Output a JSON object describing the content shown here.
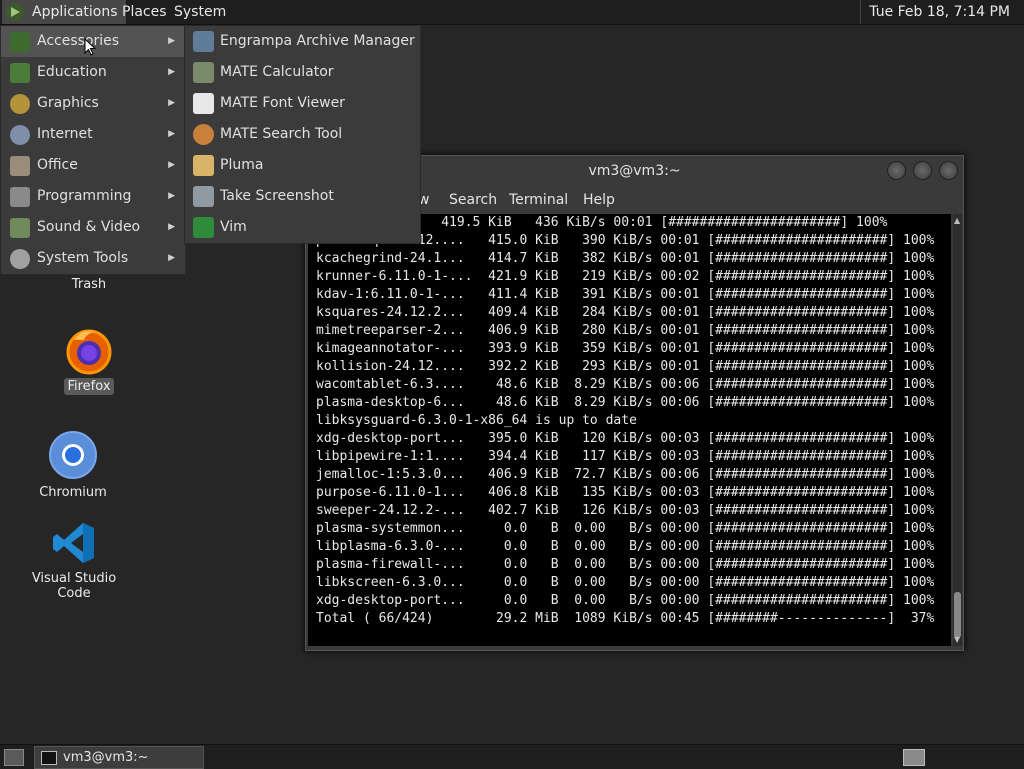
{
  "top_panel": {
    "applications": "Applications",
    "places": "Places",
    "system": "System",
    "clock": "Tue Feb 18,  7:14 PM"
  },
  "app_menu": {
    "items": [
      {
        "label": "Accessories",
        "icon": "accessories-icon"
      },
      {
        "label": "Education",
        "icon": "education-icon"
      },
      {
        "label": "Graphics",
        "icon": "graphics-icon"
      },
      {
        "label": "Internet",
        "icon": "internet-icon"
      },
      {
        "label": "Office",
        "icon": "office-icon"
      },
      {
        "label": "Programming",
        "icon": "programming-icon"
      },
      {
        "label": "Sound & Video",
        "icon": "sound-video-icon"
      },
      {
        "label": "System Tools",
        "icon": "system-tools-icon"
      }
    ]
  },
  "accessories_submenu": {
    "items": [
      {
        "label": "Engrampa Archive Manager",
        "icon": "archive-manager-icon"
      },
      {
        "label": "MATE Calculator",
        "icon": "calculator-icon"
      },
      {
        "label": "MATE Font Viewer",
        "icon": "font-viewer-icon"
      },
      {
        "label": "MATE Search Tool",
        "icon": "search-tool-icon"
      },
      {
        "label": "Pluma",
        "icon": "text-editor-icon"
      },
      {
        "label": "Take Screenshot",
        "icon": "screenshot-icon"
      },
      {
        "label": "Vim",
        "icon": "vim-icon"
      }
    ]
  },
  "desktop": {
    "trash": "Trash",
    "firefox": "Firefox",
    "chromium": "Chromium",
    "vscode": "Visual Studio Code"
  },
  "terminal": {
    "title": "vm3@vm3:~",
    "menu": [
      "w",
      "Search",
      "Terminal",
      "Help"
    ],
    "lines": [
      "phonon-1-...    419.5 KiB   436 KiB/s 00:01 [######################] 100%",
      "phonon-qt6-4.12....   415.0 KiB   390 KiB/s 00:01 [######################] 100%",
      "kcachegrind-24.1...   414.7 KiB   382 KiB/s 00:01 [######################] 100%",
      "krunner-6.11.0-1-...  421.9 KiB   219 KiB/s 00:02 [######################] 100%",
      "kdav-1:6.11.0-1-...   411.4 KiB   391 KiB/s 00:01 [######################] 100%",
      "ksquares-24.12.2...   409.4 KiB   284 KiB/s 00:01 [######################] 100%",
      "mimetreeparser-2...   406.9 KiB   280 KiB/s 00:01 [######################] 100%",
      "kimageannotator-...   393.9 KiB   359 KiB/s 00:01 [######################] 100%",
      "kollision-24.12....   392.2 KiB   293 KiB/s 00:01 [######################] 100%",
      "wacomtablet-6.3....    48.6 KiB  8.29 KiB/s 00:06 [######################] 100%",
      "plasma-desktop-6...    48.6 KiB  8.29 KiB/s 00:06 [######################] 100%",
      "libksysguard-6.3.0-1-x86_64 is up to date",
      "xdg-desktop-port...   395.0 KiB   120 KiB/s 00:03 [######################] 100%",
      "libpipewire-1:1....   394.4 KiB   117 KiB/s 00:03 [######################] 100%",
      "jemalloc-1:5.3.0...   406.9 KiB  72.7 KiB/s 00:06 [######################] 100%",
      "purpose-6.11.0-1...   406.8 KiB   135 KiB/s 00:03 [######################] 100%",
      "sweeper-24.12.2-...   402.7 KiB   126 KiB/s 00:03 [######################] 100%",
      "plasma-systemmon...     0.0   B  0.00   B/s 00:00 [######################] 100%",
      "libplasma-6.3.0-...     0.0   B  0.00   B/s 00:00 [######################] 100%",
      "plasma-firewall-...     0.0   B  0.00   B/s 00:00 [######################] 100%",
      "libkscreen-6.3.0...     0.0   B  0.00   B/s 00:00 [######################] 100%",
      "xdg-desktop-port...     0.0   B  0.00   B/s 00:00 [######################] 100%",
      "Total ( 66/424)        29.2 MiB  1089 KiB/s 00:45 [########--------------]  37%"
    ]
  },
  "bottom_panel": {
    "task": "vm3@vm3:~"
  }
}
